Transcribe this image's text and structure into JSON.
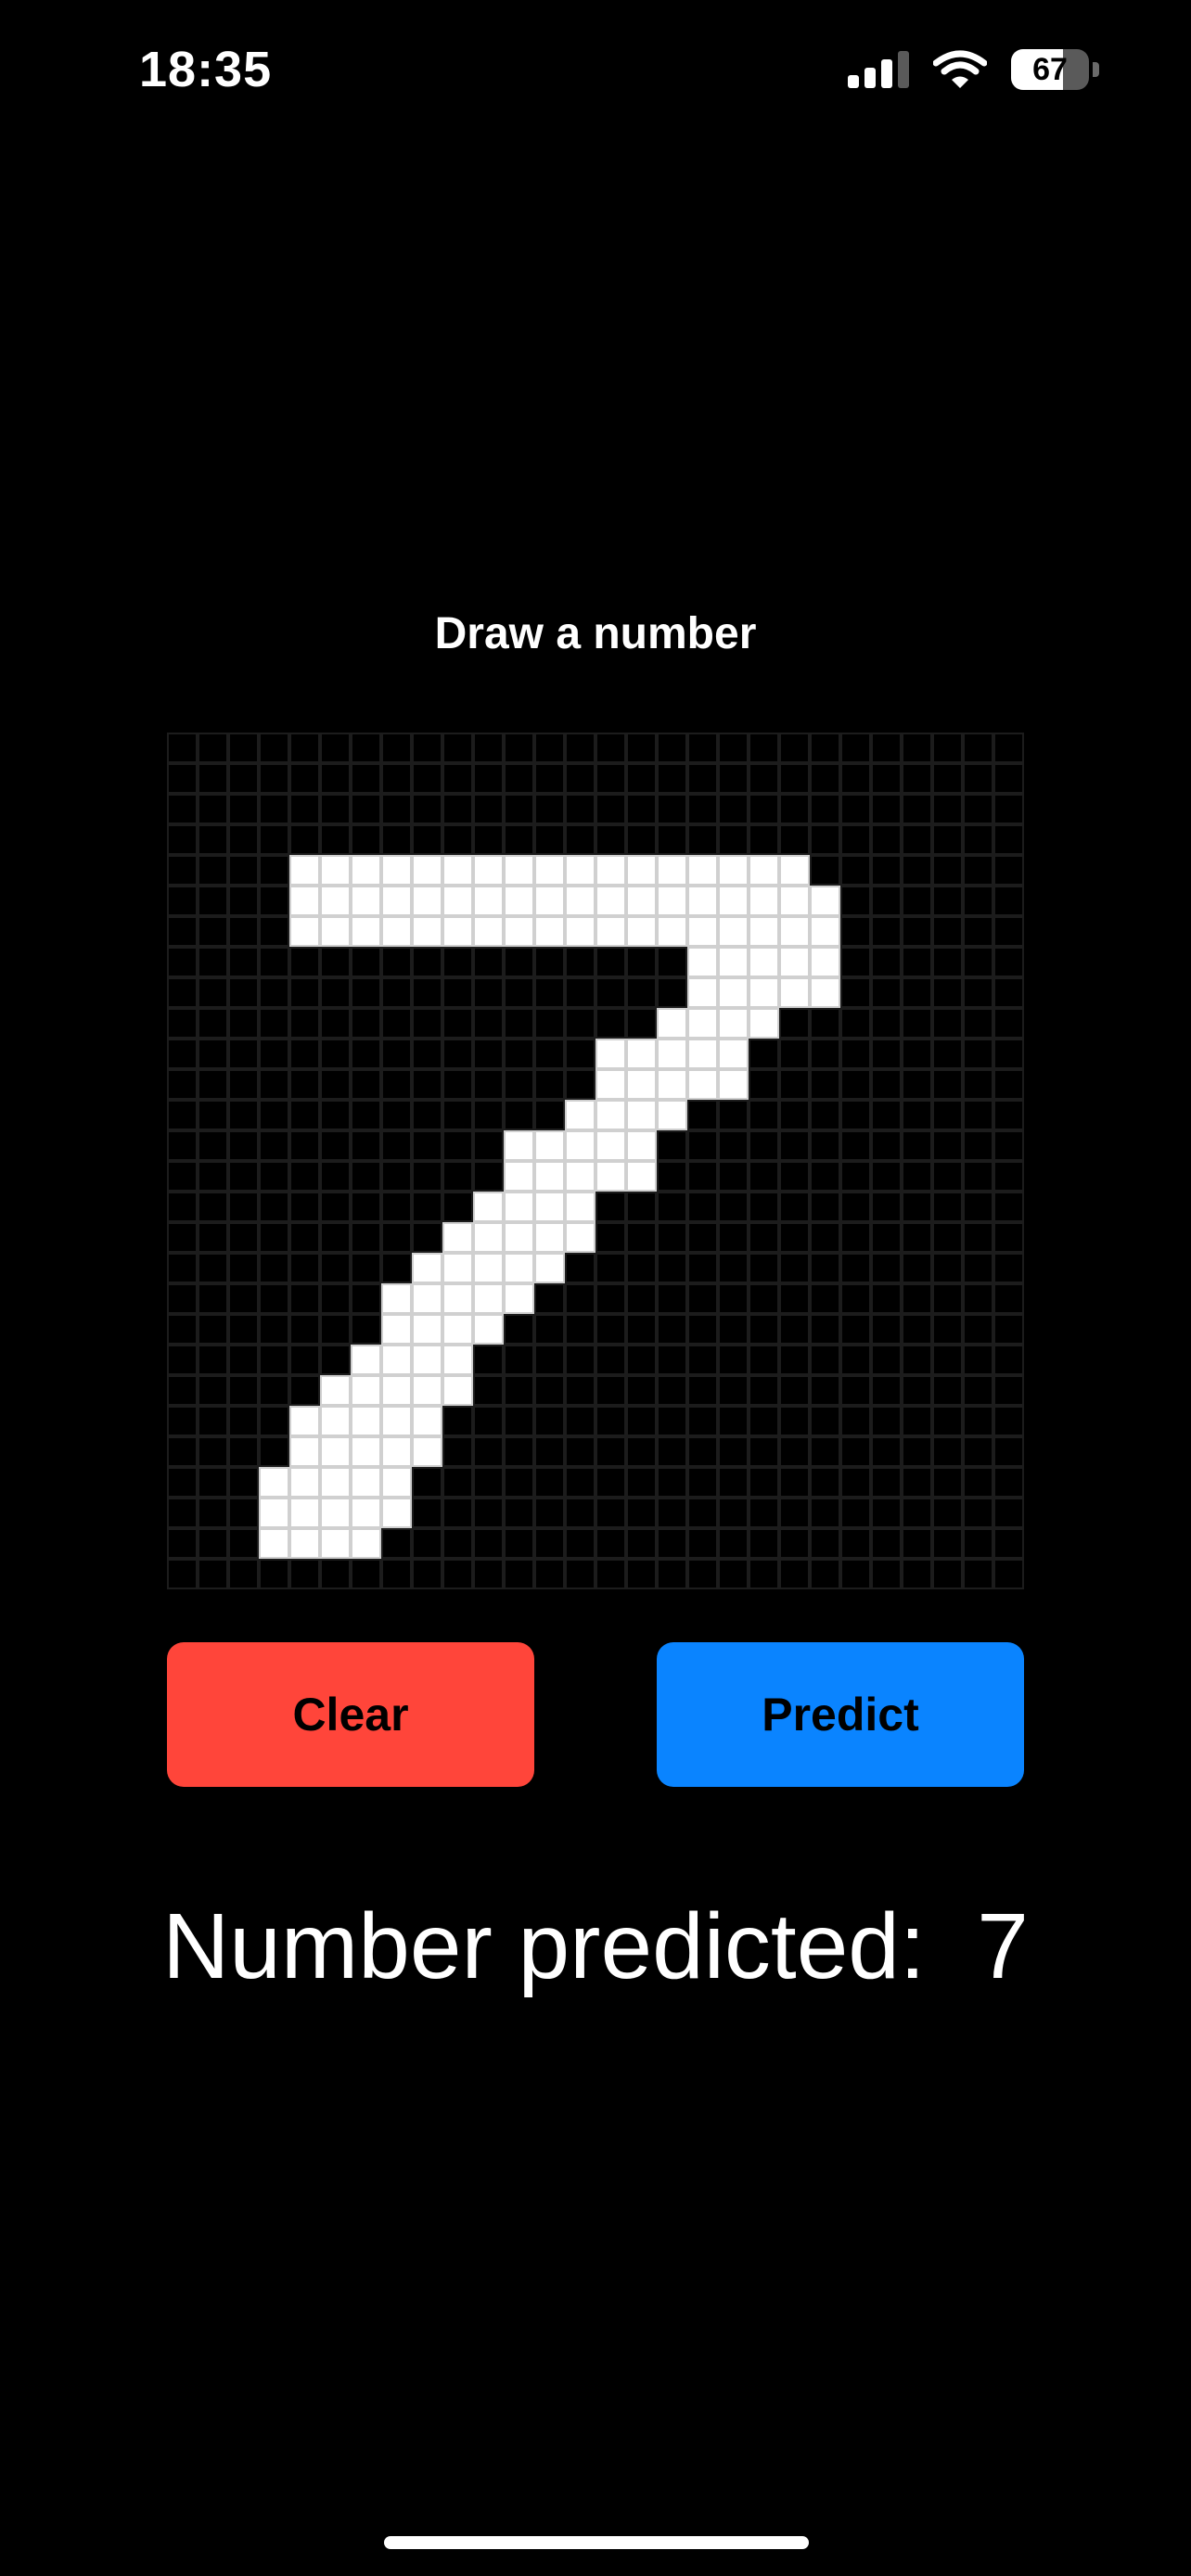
{
  "status_bar": {
    "time": "18:35",
    "signal_icon": "cellular-signal-icon",
    "wifi_icon": "wifi-icon",
    "battery_level": "67",
    "battery_fraction": 0.67
  },
  "prompt": "Draw a number",
  "canvas": {
    "rows": 28,
    "cols": 28,
    "filled": [
      [
        4,
        4
      ],
      [
        4,
        5
      ],
      [
        4,
        6
      ],
      [
        4,
        7
      ],
      [
        4,
        8
      ],
      [
        4,
        9
      ],
      [
        4,
        10
      ],
      [
        4,
        11
      ],
      [
        4,
        12
      ],
      [
        4,
        13
      ],
      [
        4,
        14
      ],
      [
        4,
        15
      ],
      [
        4,
        16
      ],
      [
        4,
        17
      ],
      [
        4,
        18
      ],
      [
        4,
        19
      ],
      [
        4,
        20
      ],
      [
        5,
        4
      ],
      [
        5,
        5
      ],
      [
        5,
        6
      ],
      [
        5,
        7
      ],
      [
        5,
        8
      ],
      [
        5,
        9
      ],
      [
        5,
        10
      ],
      [
        5,
        11
      ],
      [
        5,
        12
      ],
      [
        5,
        13
      ],
      [
        5,
        14
      ],
      [
        5,
        15
      ],
      [
        5,
        16
      ],
      [
        5,
        17
      ],
      [
        5,
        18
      ],
      [
        5,
        19
      ],
      [
        5,
        20
      ],
      [
        5,
        21
      ],
      [
        6,
        4
      ],
      [
        6,
        5
      ],
      [
        6,
        6
      ],
      [
        6,
        7
      ],
      [
        6,
        8
      ],
      [
        6,
        9
      ],
      [
        6,
        10
      ],
      [
        6,
        11
      ],
      [
        6,
        12
      ],
      [
        6,
        13
      ],
      [
        6,
        14
      ],
      [
        6,
        15
      ],
      [
        6,
        16
      ],
      [
        6,
        17
      ],
      [
        6,
        18
      ],
      [
        6,
        19
      ],
      [
        6,
        20
      ],
      [
        6,
        21
      ],
      [
        7,
        17
      ],
      [
        7,
        18
      ],
      [
        7,
        19
      ],
      [
        7,
        20
      ],
      [
        7,
        21
      ],
      [
        8,
        17
      ],
      [
        8,
        18
      ],
      [
        8,
        19
      ],
      [
        8,
        20
      ],
      [
        8,
        21
      ],
      [
        9,
        16
      ],
      [
        9,
        17
      ],
      [
        9,
        18
      ],
      [
        9,
        19
      ],
      [
        10,
        14
      ],
      [
        10,
        15
      ],
      [
        10,
        16
      ],
      [
        10,
        17
      ],
      [
        10,
        18
      ],
      [
        11,
        14
      ],
      [
        11,
        15
      ],
      [
        11,
        16
      ],
      [
        11,
        17
      ],
      [
        11,
        18
      ],
      [
        12,
        13
      ],
      [
        12,
        14
      ],
      [
        12,
        15
      ],
      [
        12,
        16
      ],
      [
        13,
        11
      ],
      [
        13,
        12
      ],
      [
        13,
        13
      ],
      [
        13,
        14
      ],
      [
        13,
        15
      ],
      [
        14,
        11
      ],
      [
        14,
        12
      ],
      [
        14,
        13
      ],
      [
        14,
        14
      ],
      [
        14,
        15
      ],
      [
        15,
        10
      ],
      [
        15,
        11
      ],
      [
        15,
        12
      ],
      [
        15,
        13
      ],
      [
        16,
        9
      ],
      [
        16,
        10
      ],
      [
        16,
        11
      ],
      [
        16,
        12
      ],
      [
        16,
        13
      ],
      [
        17,
        8
      ],
      [
        17,
        9
      ],
      [
        17,
        10
      ],
      [
        17,
        11
      ],
      [
        17,
        12
      ],
      [
        18,
        7
      ],
      [
        18,
        8
      ],
      [
        18,
        9
      ],
      [
        18,
        10
      ],
      [
        18,
        11
      ],
      [
        19,
        7
      ],
      [
        19,
        8
      ],
      [
        19,
        9
      ],
      [
        19,
        10
      ],
      [
        20,
        6
      ],
      [
        20,
        7
      ],
      [
        20,
        8
      ],
      [
        20,
        9
      ],
      [
        21,
        5
      ],
      [
        21,
        6
      ],
      [
        21,
        7
      ],
      [
        21,
        8
      ],
      [
        21,
        9
      ],
      [
        22,
        4
      ],
      [
        22,
        5
      ],
      [
        22,
        6
      ],
      [
        22,
        7
      ],
      [
        22,
        8
      ],
      [
        23,
        4
      ],
      [
        23,
        5
      ],
      [
        23,
        6
      ],
      [
        23,
        7
      ],
      [
        23,
        8
      ],
      [
        24,
        3
      ],
      [
        24,
        4
      ],
      [
        24,
        5
      ],
      [
        24,
        6
      ],
      [
        24,
        7
      ],
      [
        25,
        3
      ],
      [
        25,
        4
      ],
      [
        25,
        5
      ],
      [
        25,
        6
      ],
      [
        25,
        7
      ],
      [
        26,
        3
      ],
      [
        26,
        4
      ],
      [
        26,
        5
      ],
      [
        26,
        6
      ]
    ]
  },
  "buttons": {
    "clear_label": "Clear",
    "predict_label": "Predict"
  },
  "result": {
    "label": "Number predicted:  7"
  },
  "colors": {
    "clear_button": "#ff453a",
    "predict_button": "#0a84ff",
    "background": "#000000",
    "ink": "#ffffff"
  }
}
